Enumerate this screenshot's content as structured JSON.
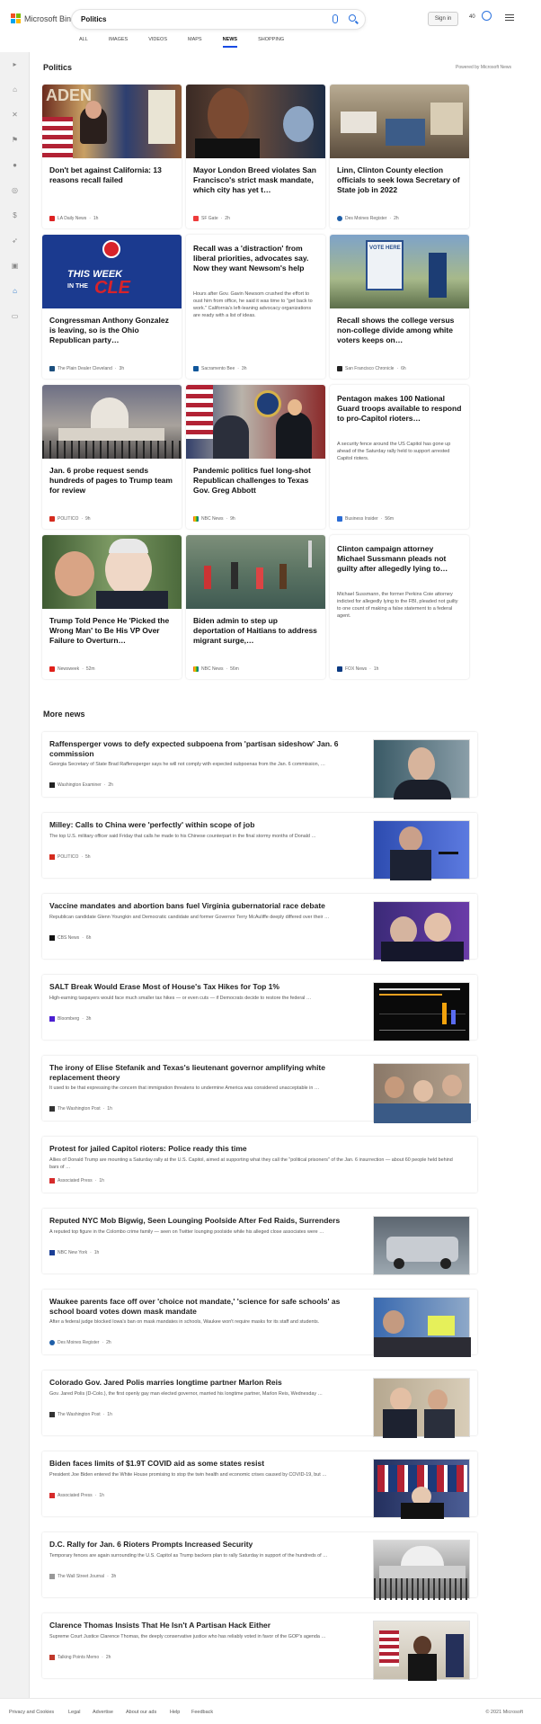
{
  "header": {
    "brand": "Microsoft Bing",
    "query": "Politics",
    "signin": "Sign in",
    "rewards": "40",
    "icons": [
      "microphone-icon",
      "search-icon",
      "rewards-trophy-icon",
      "hamburger-menu-icon"
    ]
  },
  "tabs": [
    "ALL",
    "IMAGES",
    "VIDEOS",
    "MAPS",
    "NEWS",
    "SHOPPING"
  ],
  "active_tab": "NEWS",
  "section_title": "Politics",
  "powered": "Powered by Microsoft News",
  "more_title": "More news",
  "cards": [
    {
      "title": "Don't bet against California: 13 reasons recall failed",
      "abstract": "",
      "source": "LA Daily News",
      "time": "1h"
    },
    {
      "title": "Mayor London Breed violates San Francisco's strict mask mandate, which city has yet t…",
      "abstract": "",
      "source": "SF Gate",
      "time": "2h"
    },
    {
      "title": "Linn, Clinton County election officials to seek Iowa Secretary of State job in 2022",
      "abstract": "",
      "source": "Des Moines Register",
      "time": "2h"
    },
    {
      "title": "Congressman Anthony Gonzalez is leaving, so is the Ohio Republican party…",
      "abstract": "",
      "source": "The Plain Dealer Cleveland",
      "time": "3h"
    },
    {
      "title": "Recall was a 'distraction' from liberal priorities, advocates say. Now they want Newsom's help",
      "abstract": "Hours after Gov. Gavin Newsom crushed the effort to oust him from office, he said it was time to \"get back to work.\" California's left-leaning advocacy organizations are ready with a list of ideas.",
      "source": "Sacramento Bee",
      "time": "3h"
    },
    {
      "title": "Recall shows the college versus non-college divide among white voters keeps on…",
      "abstract": "",
      "source": "San Francisco Chronicle",
      "time": "6h"
    },
    {
      "title": "Jan. 6 probe request sends hundreds of pages to Trump team for review",
      "abstract": "",
      "source": "POLITICO",
      "time": "9h"
    },
    {
      "title": "Pandemic politics fuel long-shot Republican challenges to Texas Gov. Greg Abbott",
      "abstract": "",
      "source": "NBC News",
      "time": "9h"
    },
    {
      "title": "Pentagon makes 100 National Guard troops available to respond to pro-Capitol rioters…",
      "abstract": "A security fence around the US Capitol has gone up ahead of the Saturday rally held to support arrested Capitol rioters.",
      "source": "Business Insider",
      "time": "56m"
    },
    {
      "title": "Trump Told Pence He 'Picked the Wrong Man' to Be His VP Over Failure to Overturn…",
      "abstract": "",
      "source": "Newsweek",
      "time": "52m"
    },
    {
      "title": "Biden admin to step up deportation of Haitians to address migrant surge,…",
      "abstract": "",
      "source": "NBC News",
      "time": "56m"
    },
    {
      "title": "Clinton campaign attorney Michael Sussmann pleads not guilty after allegedly lying to…",
      "abstract": "Michael Sussmann, the former Perkins Coie attorney indicted for allegedly lying to the FBI, pleaded not guilty to one count of making a false statement to a federal agent.",
      "source": "FOX News",
      "time": "1h"
    }
  ],
  "news": [
    {
      "title": "Raffensperger vows to defy expected subpoena from 'partisan sideshow' Jan. 6 commission",
      "desc": "Georgia Secretary of State Brad Raffensperger says he will not comply with expected subpoenas from the Jan. 6 commission, …",
      "source": "Washington Examiner",
      "time": "2h"
    },
    {
      "title": "Milley: Calls to China were 'perfectly' within scope of job",
      "desc": "The top U.S. military officer said Friday that calls he made to his Chinese counterpart in the final stormy months of Donald …",
      "source": "POLITICO",
      "time": "5h"
    },
    {
      "title": "Vaccine mandates and abortion bans fuel Virginia gubernatorial race debate",
      "desc": "Republican candidate Glenn Youngkin and Democratic candidate and former Governor Terry McAuliffe deeply differed over their …",
      "source": "CBS News",
      "time": "6h"
    },
    {
      "title": "SALT Break Would Erase Most of House's Tax Hikes for Top 1%",
      "desc": "High-earning taxpayers would face much smaller tax hikes — or even cuts — if Democrats decide to restore the federal …",
      "source": "Bloomberg",
      "time": "3h"
    },
    {
      "title": "The irony of Elise Stefanik and Texas's lieutenant governor amplifying white replacement theory",
      "desc": "It used to be that expressing the concern that immigration threatens to undermine America was considered unacceptable in …",
      "source": "The Washington Post",
      "time": "1h"
    },
    {
      "title": "Protest for jailed Capitol rioters: Police ready this time",
      "desc": "Allies of Donald Trump are mounting a Saturday rally at the U.S. Capitol, aimed at supporting what they call the \"political prisoners\" of the Jan. 6 insurrection — about 60 people held behind bars of …",
      "source": "Associated Press",
      "time": "1h"
    },
    {
      "title": "Reputed NYC Mob Bigwig, Seen Lounging Poolside After Fed Raids, Surrenders",
      "desc": "A reputed top figure in the Colombo crime family — seen on Twitter lounging poolside while his alleged close associates were …",
      "source": "NBC New York",
      "time": "1h"
    },
    {
      "title": "Waukee parents face off over 'choice not mandate,' 'science for safe schools' as school board votes down mask mandate",
      "desc": "After a federal judge blocked Iowa's ban on mask mandates in schools, Waukee won't require masks for its staff and students.",
      "source": "Des Moines Register",
      "time": "2h"
    },
    {
      "title": "Colorado Gov. Jared Polis marries longtime partner Marlon Reis",
      "desc": "Gov. Jared Polis (D-Colo.), the first openly gay man elected governor, married his longtime partner, Marlon Reis, Wednesday …",
      "source": "The Washington Post",
      "time": "1h"
    },
    {
      "title": "Biden faces limits of $1.9T COVID aid as some states resist",
      "desc": "President Joe Biden entered the White House promising to stop the twin health and economic crises caused by COVID-19, but …",
      "source": "Associated Press",
      "time": "1h"
    },
    {
      "title": "D.C. Rally for Jan. 6 Rioters Prompts Increased Security",
      "desc": "Temporary fences are again surrounding the U.S. Capitol as Trump backers plan to rally Saturday in support of the hundreds of …",
      "source": "The Wall Street Journal",
      "time": "3h"
    },
    {
      "title": "Clarence Thomas Insists That He Isn't A Partisan Hack Either",
      "desc": "Supreme Court Justice Clarence Thomas, the deeply conservative justice who has reliably voted in favor of the GOP's agenda …",
      "source": "Talking Points Memo",
      "time": "2h"
    }
  ],
  "card_image_text": {
    "week": "THIS WEEK",
    "in_the": "IN THE",
    "cle": "CLE",
    "vote": "VOTE HERE"
  },
  "footer": {
    "links": [
      "Privacy and Cookies",
      "Legal",
      "Advertise",
      "About our ads",
      "Help",
      "Feedback"
    ],
    "copyright": "© 2021 Microsoft"
  }
}
